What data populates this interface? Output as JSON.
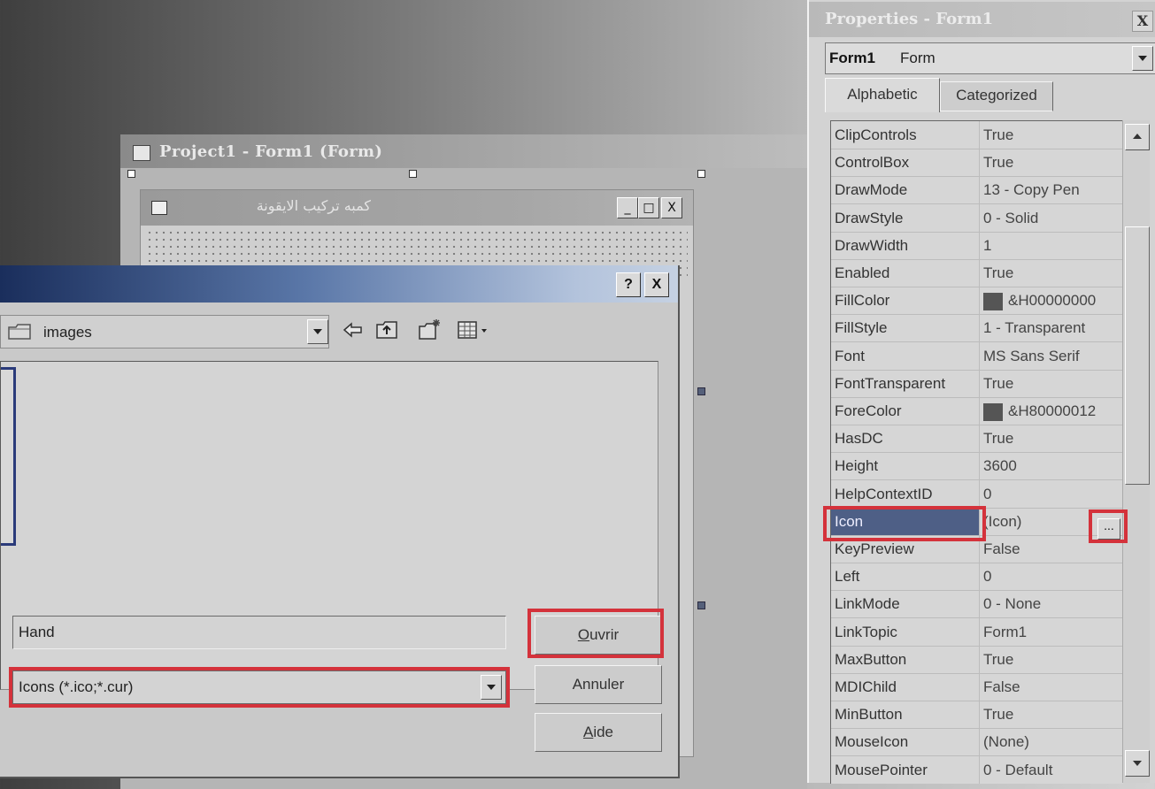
{
  "project_window": {
    "title": "Project1 - Form1 (Form)"
  },
  "inner_form": {
    "title": "كمبه تركيب الايقونة",
    "caption_minimize": "_",
    "caption_maximize": "□",
    "caption_close": "X"
  },
  "dialog": {
    "help_label": "?",
    "close_label": "X",
    "look_in_value": "images",
    "file_name_value": "Hand",
    "file_type_value": "Icons (*.ico;*.cur)",
    "open_button_accel": "O",
    "open_button_rest": "uvrir",
    "cancel_button": "Annuler",
    "help_button_accel": "A",
    "help_button_rest": "ide"
  },
  "properties": {
    "title": "Properties - Form1",
    "close_label": "X",
    "object_name": "Form1",
    "object_type": "Form",
    "tab_alphabetic": "Alphabetic",
    "tab_categorized": "Categorized",
    "ellipsis_label": "...",
    "rows": [
      {
        "name": "ClipControls",
        "value": "True"
      },
      {
        "name": "ControlBox",
        "value": "True"
      },
      {
        "name": "DrawMode",
        "value": "13 - Copy Pen"
      },
      {
        "name": "DrawStyle",
        "value": "0 - Solid"
      },
      {
        "name": "DrawWidth",
        "value": "1"
      },
      {
        "name": "Enabled",
        "value": "True"
      },
      {
        "name": "FillColor",
        "value": "&H00000000",
        "swatch": "#555555"
      },
      {
        "name": "FillStyle",
        "value": "1 - Transparent"
      },
      {
        "name": "Font",
        "value": "MS Sans Serif"
      },
      {
        "name": "FontTransparent",
        "value": "True"
      },
      {
        "name": "ForeColor",
        "value": "&H80000012",
        "swatch": "#555555"
      },
      {
        "name": "HasDC",
        "value": "True"
      },
      {
        "name": "Height",
        "value": "3600"
      },
      {
        "name": "HelpContextID",
        "value": "0"
      },
      {
        "name": "Icon",
        "value": "(Icon)",
        "selected": true
      },
      {
        "name": "KeyPreview",
        "value": "False"
      },
      {
        "name": "Left",
        "value": "0"
      },
      {
        "name": "LinkMode",
        "value": "0 - None"
      },
      {
        "name": "LinkTopic",
        "value": "Form1"
      },
      {
        "name": "MaxButton",
        "value": "True"
      },
      {
        "name": "MDIChild",
        "value": "False"
      },
      {
        "name": "MinButton",
        "value": "True"
      },
      {
        "name": "MouseIcon",
        "value": "(None)"
      },
      {
        "name": "MousePointer",
        "value": "0 - Default"
      }
    ]
  },
  "colors": {
    "highlight_box": "#d4323b",
    "selected_row": "#4e5f86",
    "dialog_title_start": "#1a2e5c"
  }
}
